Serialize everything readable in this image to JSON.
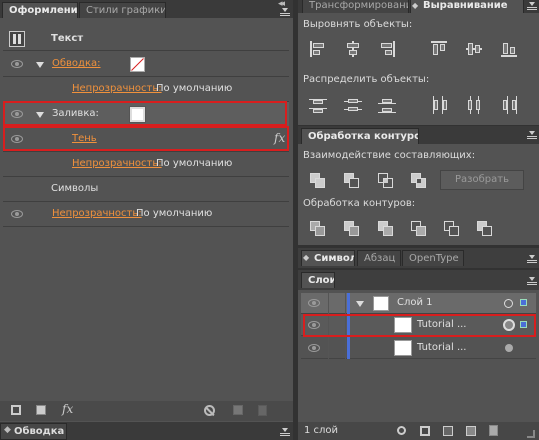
{
  "appearance_panel": {
    "tab_active": "Оформление",
    "tab_inactive": "Стили графики",
    "header_label": "Текст",
    "rows": {
      "stroke_label": "Обводка:",
      "stroke_opacity_label": "Непрозрачность:",
      "stroke_opacity_value": "По умолчанию",
      "fill_label": "Заливка:",
      "shadow_label": "Тень",
      "fx_label": "fx",
      "fill_opacity_label": "Непрозрачность:",
      "fill_opacity_value": "По умолчанию",
      "characters_label": "Символы",
      "opacity_label": "Непрозрачность:",
      "opacity_value": "По умолчанию"
    },
    "bottom_fx": "fx"
  },
  "bottom_collapsed_tab": "Обводка",
  "transform_tabs": {
    "transform": "Трансформирование",
    "align": "Выравнивание"
  },
  "align_panel": {
    "align_objects_title": "Выровнять объекты:",
    "distribute_objects_title": "Распределить объекты:"
  },
  "pathfinder_panel": {
    "tab": "Обработка контуров",
    "shape_modes_title": "Взаимодействие составляющих:",
    "expand_button": "Разобрать",
    "pathfinders_title": "Обработка контуров:"
  },
  "char_tabs": {
    "symbol": "Символ",
    "paragraph": "Абзац",
    "opentype": "OpenType"
  },
  "layers_panel": {
    "tab": "Слои",
    "layer_name": "Слой 1",
    "items": [
      "Tutorial ...",
      "Tutorial ..."
    ],
    "footer_count": "1 слой"
  },
  "colors": {
    "accent_orange": "#f0913c",
    "highlight_red": "#d81e1e",
    "layer_blue": "#4a6fd8"
  }
}
